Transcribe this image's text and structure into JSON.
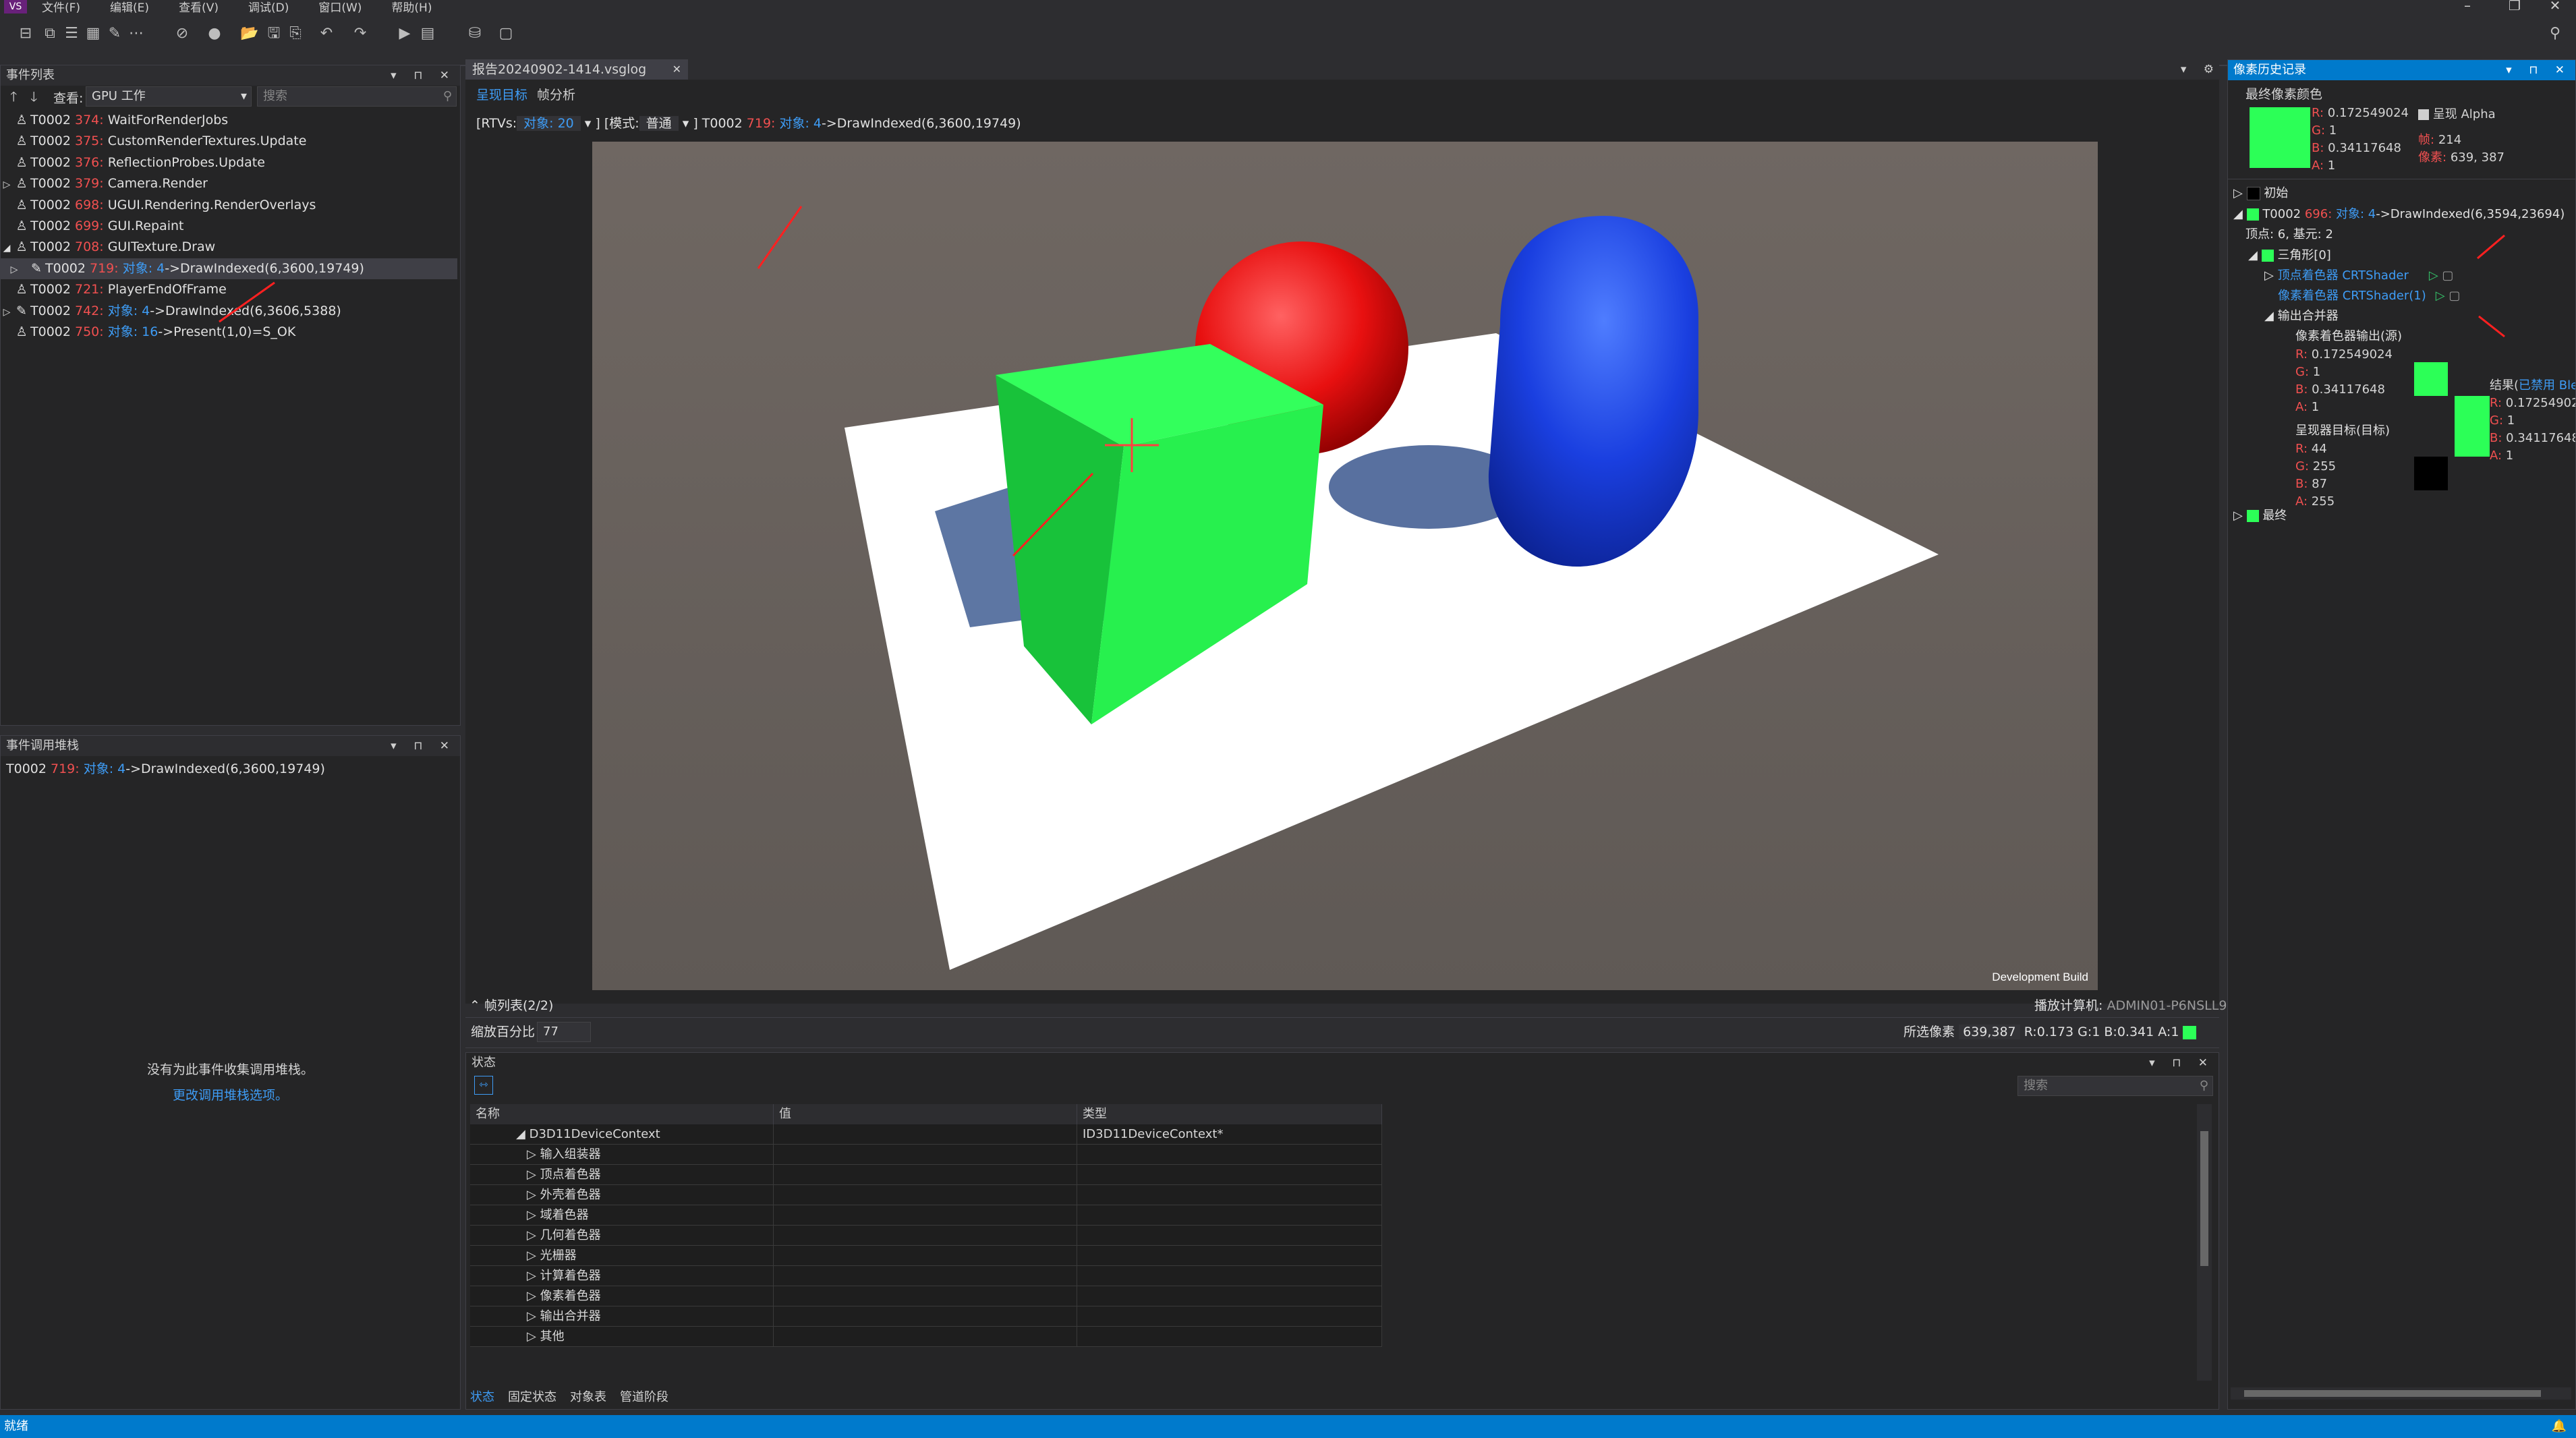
{
  "menubar": {
    "items": [
      "文件(F)",
      "编辑(E)",
      "查看(V)",
      "调试(D)",
      "窗口(W)",
      "帮助(H)"
    ]
  },
  "events_panel": {
    "title": "事件列表",
    "filter_label": "查看:",
    "filter_value": "GPU 工作",
    "search_placeholder": "搜索",
    "rows": [
      {
        "prefix": "T0002 ",
        "num": "374:",
        "text": " WaitForRenderJobs"
      },
      {
        "prefix": "T0002 ",
        "num": "375:",
        "text": " CustomRenderTextures.Update"
      },
      {
        "prefix": "T0002 ",
        "num": "376:",
        "text": " ReflectionProbes.Update"
      },
      {
        "prefix": "T0002 ",
        "num": "379:",
        "text": " Camera.Render"
      },
      {
        "prefix": "T0002 ",
        "num": "698:",
        "text": " UGUI.Rendering.RenderOverlays"
      },
      {
        "prefix": "T0002 ",
        "num": "699:",
        "text": " GUI.Repaint"
      },
      {
        "prefix": "T0002 ",
        "num": "708:",
        "text": " GUITexture.Draw"
      },
      {
        "prefix": "T0002 ",
        "num": "719:",
        "obj": " 对象: 4",
        "text": "->DrawIndexed(6,3600,19749)"
      },
      {
        "prefix": "T0002 ",
        "num": "721:",
        "text": " PlayerEndOfFrame"
      },
      {
        "prefix": "T0002 ",
        "num": "742:",
        "obj": " 对象: 4",
        "text": "->DrawIndexed(6,3606,5388)"
      },
      {
        "prefix": "T0002 ",
        "num": "750:",
        "obj": " 对象: 16",
        "text": "->Present(1,0)=S_OK"
      }
    ]
  },
  "callstack_panel": {
    "title": "事件调用堆栈",
    "entry_prefix": "T0002 ",
    "entry_num": "719:",
    "entry_obj": " 对象: 4",
    "entry_text": "->DrawIndexed(6,3600,19749)",
    "empty_message": "没有为此事件收集调用堆栈。",
    "options_link": "更改调用堆栈选项。"
  },
  "doc": {
    "tab": "报告20240902-1414.vsglog",
    "subtabs": [
      "呈现目标",
      "帧分析"
    ],
    "rtv_label": "[RTVs:",
    "rtv_value": "对象: 20",
    "mode_label": "] [模式:",
    "mode_value": "普通",
    "event_prefix": "] T0002 ",
    "event_num": "719:",
    "event_obj": " 对象: 4",
    "event_text": "->DrawIndexed(6,3600,19749)",
    "watermark": "Development Build",
    "frame_list": "帧列表(2/2)",
    "playback_label": "播放计算机:",
    "playback_value": "ADMIN01-P6NSLL9",
    "zoom_label": "缩放百分比",
    "zoom_value": "77",
    "selected_label": "所选像素",
    "selected_coord": "639,387",
    "selected_rgba": "R:0.173 G:1 B:0.341 A:1"
  },
  "state_panel": {
    "title": "状态",
    "search_placeholder": "搜索",
    "columns": [
      "名称",
      "值",
      "类型"
    ],
    "root_name": "D3D11DeviceContext",
    "root_type": "ID3D11DeviceContext*",
    "children": [
      "输入组装器",
      "顶点着色器",
      "外壳着色器",
      "域着色器",
      "几何着色器",
      "光栅器",
      "计算着色器",
      "像素着色器",
      "输出合并器",
      "其他"
    ],
    "bottom_tabs": [
      "状态",
      "固定状态",
      "对象表",
      "管道阶段"
    ]
  },
  "pixel_panel": {
    "title": "像素历史记录",
    "final_label": "最终像素颜色",
    "final_r": "0.172549024",
    "final_g": "1",
    "final_b": "0.34117648",
    "final_a": "1",
    "show_alpha": "呈现 Alpha",
    "frame_label": "帧:",
    "frame_value": "214",
    "pixel_label": "像素:",
    "pixel_value": "639, 387",
    "initial": "初始",
    "event_prefix": "T0002 ",
    "event_num": "696:",
    "event_obj": " 对象: 4",
    "event_text": "->DrawIndexed(6,3594,23694)",
    "verts": "顶点: 6, 基元: 2",
    "triangle": "三角形[0]",
    "vs_label": "顶点着色器",
    "vs_name": "CRTShader",
    "ps_label": "像素着色器",
    "ps_name": "CRTShader(1)",
    "merger": "输出合并器",
    "ps_output": "像素着色器输出(源)",
    "src_r": "0.172549024",
    "src_g": "1",
    "src_b": "0.34117648",
    "src_a": "1",
    "rt_target": "呈现器目标(目标)",
    "dst_r": "44",
    "dst_g": "255",
    "dst_b": "87",
    "dst_a": "255",
    "result_label": "结果(",
    "result_blend": "已禁用 Ble",
    "res_r": "0.17254902",
    "res_g": "1",
    "res_b": "0.34117648",
    "res_a": "1",
    "final": "最终"
  },
  "statusbar": {
    "text": "就绪"
  },
  "colors": {
    "accent": "#007acc",
    "pixel_green": "#2cff57",
    "red_number": "#f05050",
    "blue_link": "#3e9cf5",
    "scene_bg": "#6c6460"
  }
}
